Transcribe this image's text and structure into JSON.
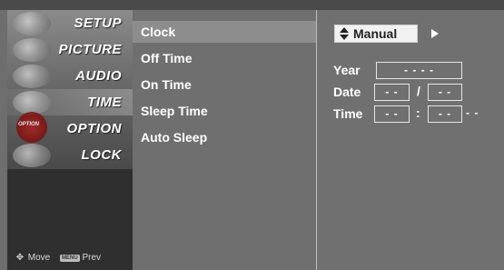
{
  "categories": [
    {
      "label": "SETUP",
      "icon": "setup-icon",
      "selected": false
    },
    {
      "label": "PICTURE",
      "icon": "picture-icon",
      "selected": false
    },
    {
      "label": "AUDIO",
      "icon": "audio-icon",
      "selected": false
    },
    {
      "label": "TIME",
      "icon": "time-icon",
      "selected": true
    },
    {
      "label": "OPTION",
      "icon": "option-icon",
      "selected": false
    },
    {
      "label": "LOCK",
      "icon": "lock-icon",
      "selected": false
    }
  ],
  "option_icon_text": "OPTION",
  "footer": {
    "move_icon": "move-icon",
    "move_label": "Move",
    "menu_key": "MENU",
    "prev_label": "Prev"
  },
  "submenu": {
    "items": [
      "Clock",
      "Off Time",
      "On Time",
      "Sleep Time",
      "Auto Sleep"
    ],
    "active_index": 0
  },
  "clock": {
    "mode": "Manual",
    "mode_icon": "up-down-icon",
    "next_icon": "play-arrow-icon",
    "year_label": "Year",
    "year_value": "- - - -",
    "date_label": "Date",
    "date_month": "- -",
    "date_sep": "/",
    "date_day": "- -",
    "time_label": "Time",
    "time_hour": "- -",
    "time_sep": ":",
    "time_minute": "- -",
    "time_ampm": "- -"
  },
  "colors": {
    "panel": "#6f6f6f",
    "highlight": "#8d8d8d",
    "mode_box": "#f2f2f2"
  }
}
